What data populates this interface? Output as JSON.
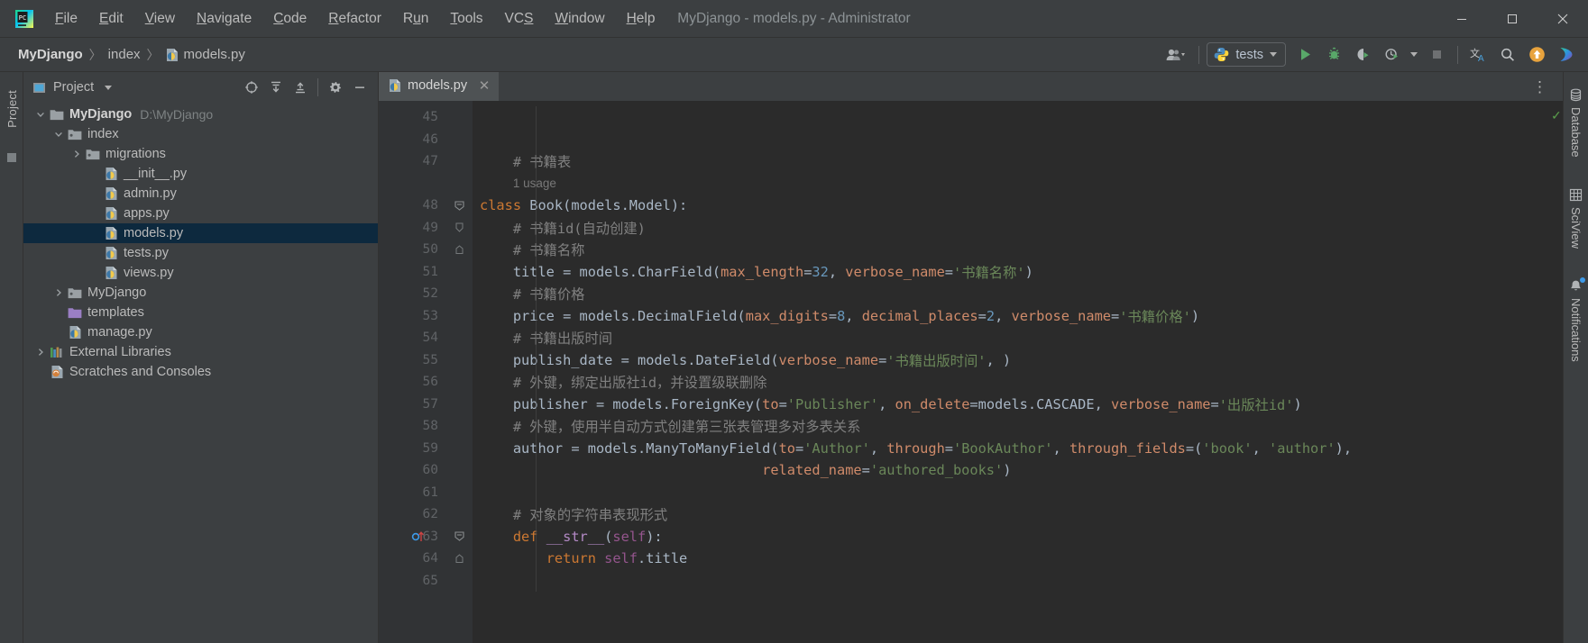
{
  "window": {
    "title": "MyDjango - models.py - Administrator",
    "app_icon": "pycharm-logo-icon",
    "controls": {
      "minimize": "─",
      "maximize": "□",
      "close": "✕"
    }
  },
  "menubar": {
    "items": [
      {
        "label": "File",
        "mnemonic": "F"
      },
      {
        "label": "Edit",
        "mnemonic": "E"
      },
      {
        "label": "View",
        "mnemonic": "V"
      },
      {
        "label": "Navigate",
        "mnemonic": "N"
      },
      {
        "label": "Code",
        "mnemonic": "C"
      },
      {
        "label": "Refactor",
        "mnemonic": "R"
      },
      {
        "label": "Run",
        "mnemonic": "u"
      },
      {
        "label": "Tools",
        "mnemonic": "T"
      },
      {
        "label": "VCS",
        "mnemonic": "S"
      },
      {
        "label": "Window",
        "mnemonic": "W"
      },
      {
        "label": "Help",
        "mnemonic": "H"
      }
    ]
  },
  "breadcrumb": {
    "items": [
      {
        "label": "MyDjango",
        "icon": "project-icon",
        "bold": true
      },
      {
        "label": "index",
        "icon": "folder-icon",
        "bold": false
      },
      {
        "label": "models.py",
        "icon": "python-file-icon",
        "bold": false
      }
    ],
    "separator": "〉"
  },
  "toolbar": {
    "user_icon": "user-avatar-icon",
    "run_configuration": {
      "label": "tests",
      "icon": "python-icon"
    },
    "buttons": [
      {
        "name": "run-button",
        "icon": "play-icon",
        "tooltip": "Run"
      },
      {
        "name": "debug-button",
        "icon": "bug-icon",
        "tooltip": "Debug"
      },
      {
        "name": "coverage-button",
        "icon": "coverage-icon",
        "tooltip": "Run with Coverage"
      },
      {
        "name": "profile-button",
        "icon": "profile-icon",
        "tooltip": "Profile"
      },
      {
        "name": "stop-button",
        "icon": "stop-icon",
        "tooltip": "Stop"
      },
      {
        "name": "translate-button",
        "icon": "translate-icon",
        "tooltip": "Translate"
      },
      {
        "name": "search-button",
        "icon": "search-icon",
        "tooltip": "Search Everywhere"
      },
      {
        "name": "update-button",
        "icon": "update-arrow-icon",
        "tooltip": "Update Project"
      },
      {
        "name": "plugin-button",
        "icon": "colorful-play-icon",
        "tooltip": "Plugin"
      }
    ]
  },
  "left_stripe": {
    "label": "Project",
    "structure_icon": "structure-icon"
  },
  "project_panel": {
    "title": "Project",
    "title_icon": "project-view-icon",
    "actions": [
      {
        "name": "scroll-from-source-button",
        "icon": "target-icon"
      },
      {
        "name": "expand-all-button",
        "icon": "expand-all-icon"
      },
      {
        "name": "collapse-all-button",
        "icon": "collapse-all-icon"
      },
      {
        "name": "settings-button",
        "icon": "gear-icon"
      },
      {
        "name": "hide-button",
        "icon": "minus-icon"
      }
    ],
    "tree": [
      {
        "label": "MyDjango",
        "sub": "D:\\MyDjango",
        "depth": 0,
        "twisty": "expanded",
        "icon": "folder-module-icon",
        "bold": true,
        "selected": false
      },
      {
        "label": "index",
        "sub": "",
        "depth": 1,
        "twisty": "expanded",
        "icon": "folder-source-icon",
        "bold": false,
        "selected": false
      },
      {
        "label": "migrations",
        "sub": "",
        "depth": 2,
        "twisty": "collapsed",
        "icon": "folder-source-icon",
        "bold": false,
        "selected": false
      },
      {
        "label": "__init__.py",
        "sub": "",
        "depth": 3,
        "twisty": "none",
        "icon": "python-file-icon",
        "bold": false,
        "selected": false
      },
      {
        "label": "admin.py",
        "sub": "",
        "depth": 3,
        "twisty": "none",
        "icon": "python-file-icon",
        "bold": false,
        "selected": false
      },
      {
        "label": "apps.py",
        "sub": "",
        "depth": 3,
        "twisty": "none",
        "icon": "python-file-icon",
        "bold": false,
        "selected": false
      },
      {
        "label": "models.py",
        "sub": "",
        "depth": 3,
        "twisty": "none",
        "icon": "python-file-icon",
        "bold": false,
        "selected": true
      },
      {
        "label": "tests.py",
        "sub": "",
        "depth": 3,
        "twisty": "none",
        "icon": "python-file-icon",
        "bold": false,
        "selected": false
      },
      {
        "label": "views.py",
        "sub": "",
        "depth": 3,
        "twisty": "none",
        "icon": "python-file-icon",
        "bold": false,
        "selected": false
      },
      {
        "label": "MyDjango",
        "sub": "",
        "depth": 1,
        "twisty": "collapsed",
        "icon": "folder-source-icon",
        "bold": false,
        "selected": false
      },
      {
        "label": "templates",
        "sub": "",
        "depth": 1,
        "twisty": "none",
        "icon": "folder-templates-icon",
        "bold": false,
        "selected": false
      },
      {
        "label": "manage.py",
        "sub": "",
        "depth": 1,
        "twisty": "none",
        "icon": "python-file-icon",
        "bold": false,
        "selected": false
      },
      {
        "label": "External Libraries",
        "sub": "",
        "depth": 0,
        "twisty": "collapsed",
        "icon": "libraries-icon",
        "bold": false,
        "selected": false
      },
      {
        "label": "Scratches and Consoles",
        "sub": "",
        "depth": 0,
        "twisty": "none",
        "icon": "scratches-icon",
        "bold": false,
        "selected": false
      }
    ]
  },
  "editor": {
    "tab": {
      "label": "models.py",
      "icon": "python-file-icon",
      "close": "✕"
    },
    "overflow_menu": "⋮",
    "inspection_status": "✓",
    "first_line_number": 45,
    "lines": [
      {
        "n": 45,
        "fold": "",
        "current": false,
        "tokens": []
      },
      {
        "n": 46,
        "fold": "",
        "current": false,
        "tokens": []
      },
      {
        "n": 47,
        "fold": "",
        "current": false,
        "tokens": [
          {
            "t": "    ",
            "c": "tok-punct"
          },
          {
            "t": "# 书籍表",
            "c": "tok-cmt"
          }
        ]
      },
      {
        "n": "",
        "fold": "",
        "current": false,
        "tokens": [
          {
            "t": "    ",
            "c": "tok-punct"
          },
          {
            "t": "1 usage",
            "c": "tok-usage"
          }
        ]
      },
      {
        "n": 48,
        "fold": "minus",
        "current": false,
        "tokens": [
          {
            "t": "class ",
            "c": "tok-kw"
          },
          {
            "t": "Book",
            "c": "tok-cls"
          },
          {
            "t": "(models.Model):",
            "c": "tok-punct"
          }
        ]
      },
      {
        "n": 49,
        "fold": "bar",
        "current": false,
        "tokens": [
          {
            "t": "    ",
            "c": "tok-punct"
          },
          {
            "t": "# 书籍id(自动创建)",
            "c": "tok-cmt"
          }
        ]
      },
      {
        "n": 50,
        "fold": "end",
        "current": false,
        "tokens": [
          {
            "t": "    ",
            "c": "tok-punct"
          },
          {
            "t": "# 书籍名称",
            "c": "tok-cmt"
          }
        ]
      },
      {
        "n": 51,
        "fold": "",
        "current": false,
        "tokens": [
          {
            "t": "    title ",
            "c": "tok-name"
          },
          {
            "t": "= ",
            "c": "tok-punct"
          },
          {
            "t": "models.CharField(",
            "c": "tok-name"
          },
          {
            "t": "max_length",
            "c": "tok-kwarg"
          },
          {
            "t": "=",
            "c": "tok-punct"
          },
          {
            "t": "32",
            "c": "tok-num"
          },
          {
            "t": ", ",
            "c": "tok-punct"
          },
          {
            "t": "verbose_name",
            "c": "tok-kwarg"
          },
          {
            "t": "=",
            "c": "tok-punct"
          },
          {
            "t": "'书籍名称'",
            "c": "tok-str"
          },
          {
            "t": ")",
            "c": "tok-punct"
          }
        ]
      },
      {
        "n": 52,
        "fold": "",
        "current": false,
        "tokens": [
          {
            "t": "    ",
            "c": "tok-punct"
          },
          {
            "t": "# 书籍价格",
            "c": "tok-cmt"
          }
        ]
      },
      {
        "n": 53,
        "fold": "",
        "current": false,
        "tokens": [
          {
            "t": "    price ",
            "c": "tok-name"
          },
          {
            "t": "= ",
            "c": "tok-punct"
          },
          {
            "t": "models.DecimalField(",
            "c": "tok-name"
          },
          {
            "t": "max_digits",
            "c": "tok-kwarg"
          },
          {
            "t": "=",
            "c": "tok-punct"
          },
          {
            "t": "8",
            "c": "tok-num"
          },
          {
            "t": ", ",
            "c": "tok-punct"
          },
          {
            "t": "decimal_places",
            "c": "tok-kwarg"
          },
          {
            "t": "=",
            "c": "tok-punct"
          },
          {
            "t": "2",
            "c": "tok-num"
          },
          {
            "t": ", ",
            "c": "tok-punct"
          },
          {
            "t": "verbose_name",
            "c": "tok-kwarg"
          },
          {
            "t": "=",
            "c": "tok-punct"
          },
          {
            "t": "'书籍价格'",
            "c": "tok-str"
          },
          {
            "t": ")",
            "c": "tok-punct"
          }
        ]
      },
      {
        "n": 54,
        "fold": "",
        "current": false,
        "tokens": [
          {
            "t": "    ",
            "c": "tok-punct"
          },
          {
            "t": "# 书籍出版时间",
            "c": "tok-cmt"
          }
        ]
      },
      {
        "n": 55,
        "fold": "",
        "current": false,
        "tokens": [
          {
            "t": "    publish_date ",
            "c": "tok-name"
          },
          {
            "t": "= ",
            "c": "tok-punct"
          },
          {
            "t": "models.DateField(",
            "c": "tok-name"
          },
          {
            "t": "verbose_name",
            "c": "tok-kwarg"
          },
          {
            "t": "=",
            "c": "tok-punct"
          },
          {
            "t": "'书籍出版时间'",
            "c": "tok-str"
          },
          {
            "t": ", )",
            "c": "tok-punct"
          }
        ]
      },
      {
        "n": 56,
        "fold": "",
        "current": false,
        "tokens": [
          {
            "t": "    ",
            "c": "tok-punct"
          },
          {
            "t": "# 外键，绑定出版社id，并设置级联删除",
            "c": "tok-cmt"
          }
        ]
      },
      {
        "n": 57,
        "fold": "",
        "current": false,
        "tokens": [
          {
            "t": "    publisher ",
            "c": "tok-name"
          },
          {
            "t": "= ",
            "c": "tok-punct"
          },
          {
            "t": "models.ForeignKey(",
            "c": "tok-name"
          },
          {
            "t": "to",
            "c": "tok-kwarg"
          },
          {
            "t": "=",
            "c": "tok-punct"
          },
          {
            "t": "'Publisher'",
            "c": "tok-str"
          },
          {
            "t": ", ",
            "c": "tok-punct"
          },
          {
            "t": "on_delete",
            "c": "tok-kwarg"
          },
          {
            "t": "=",
            "c": "tok-punct"
          },
          {
            "t": "models.CASCADE",
            "c": "tok-name"
          },
          {
            "t": ", ",
            "c": "tok-punct"
          },
          {
            "t": "verbose_name",
            "c": "tok-kwarg"
          },
          {
            "t": "=",
            "c": "tok-punct"
          },
          {
            "t": "'出版社id'",
            "c": "tok-str"
          },
          {
            "t": ")",
            "c": "tok-punct"
          }
        ]
      },
      {
        "n": 58,
        "fold": "",
        "current": false,
        "tokens": [
          {
            "t": "    ",
            "c": "tok-punct"
          },
          {
            "t": "# 外键，使用半自动方式创建第三张表管理多对多表关系",
            "c": "tok-cmt"
          }
        ]
      },
      {
        "n": 59,
        "fold": "",
        "current": false,
        "tokens": [
          {
            "t": "    author ",
            "c": "tok-name"
          },
          {
            "t": "= ",
            "c": "tok-punct"
          },
          {
            "t": "models.ManyToManyField(",
            "c": "tok-name"
          },
          {
            "t": "to",
            "c": "tok-kwarg"
          },
          {
            "t": "=",
            "c": "tok-punct"
          },
          {
            "t": "'Author'",
            "c": "tok-str"
          },
          {
            "t": ", ",
            "c": "tok-punct"
          },
          {
            "t": "through",
            "c": "tok-kwarg"
          },
          {
            "t": "=",
            "c": "tok-punct"
          },
          {
            "t": "'BookAuthor'",
            "c": "tok-str"
          },
          {
            "t": ", ",
            "c": "tok-punct"
          },
          {
            "t": "through_fields",
            "c": "tok-kwarg"
          },
          {
            "t": "=(",
            "c": "tok-punct"
          },
          {
            "t": "'book'",
            "c": "tok-str"
          },
          {
            "t": ", ",
            "c": "tok-punct"
          },
          {
            "t": "'author'",
            "c": "tok-str"
          },
          {
            "t": "),",
            "c": "tok-punct"
          }
        ]
      },
      {
        "n": 60,
        "fold": "",
        "current": false,
        "tokens": [
          {
            "t": "                                  ",
            "c": "tok-punct"
          },
          {
            "t": "related_name",
            "c": "tok-kwarg"
          },
          {
            "t": "=",
            "c": "tok-punct"
          },
          {
            "t": "'authored_books'",
            "c": "tok-str"
          },
          {
            "t": ")",
            "c": "tok-punct"
          }
        ]
      },
      {
        "n": 61,
        "fold": "",
        "current": false,
        "tokens": []
      },
      {
        "n": 62,
        "fold": "",
        "current": false,
        "tokens": [
          {
            "t": "    ",
            "c": "tok-punct"
          },
          {
            "t": "# 对象的字符串表现形式",
            "c": "tok-cmt"
          }
        ]
      },
      {
        "n": 63,
        "fold": "minus",
        "current": false,
        "gutter_icon": "override-method-icon",
        "tokens": [
          {
            "t": "    ",
            "c": "tok-punct"
          },
          {
            "t": "def ",
            "c": "tok-kw"
          },
          {
            "t": "__str__",
            "c": "tok-magic"
          },
          {
            "t": "(",
            "c": "tok-punct"
          },
          {
            "t": "self",
            "c": "tok-self"
          },
          {
            "t": "):",
            "c": "tok-punct"
          }
        ]
      },
      {
        "n": 64,
        "fold": "end",
        "current": false,
        "tokens": [
          {
            "t": "        ",
            "c": "tok-punct"
          },
          {
            "t": "return ",
            "c": "tok-kw"
          },
          {
            "t": "self",
            "c": "tok-self"
          },
          {
            "t": ".title",
            "c": "tok-name"
          }
        ]
      },
      {
        "n": 65,
        "fold": "",
        "current": false,
        "tokens": []
      }
    ]
  },
  "right_stripe": {
    "items": [
      {
        "label": "Database",
        "icon": "database-icon",
        "badge": false
      },
      {
        "label": "SciView",
        "icon": "sciview-grid-icon",
        "badge": false
      },
      {
        "label": "Notifications",
        "icon": "bell-icon",
        "badge": true
      }
    ]
  },
  "colors": {
    "background": "#2b2b2b",
    "chrome": "#3c3f41",
    "gutter": "#313335",
    "selection": "#0d293e",
    "accent_green": "#59a869",
    "accent_orange": "#e8a33d",
    "keyword": "#cc7832",
    "string": "#6a8759",
    "number": "#6897bb",
    "comment": "#808080",
    "kwarg": "#d08b6a",
    "text": "#a9b7c6"
  }
}
